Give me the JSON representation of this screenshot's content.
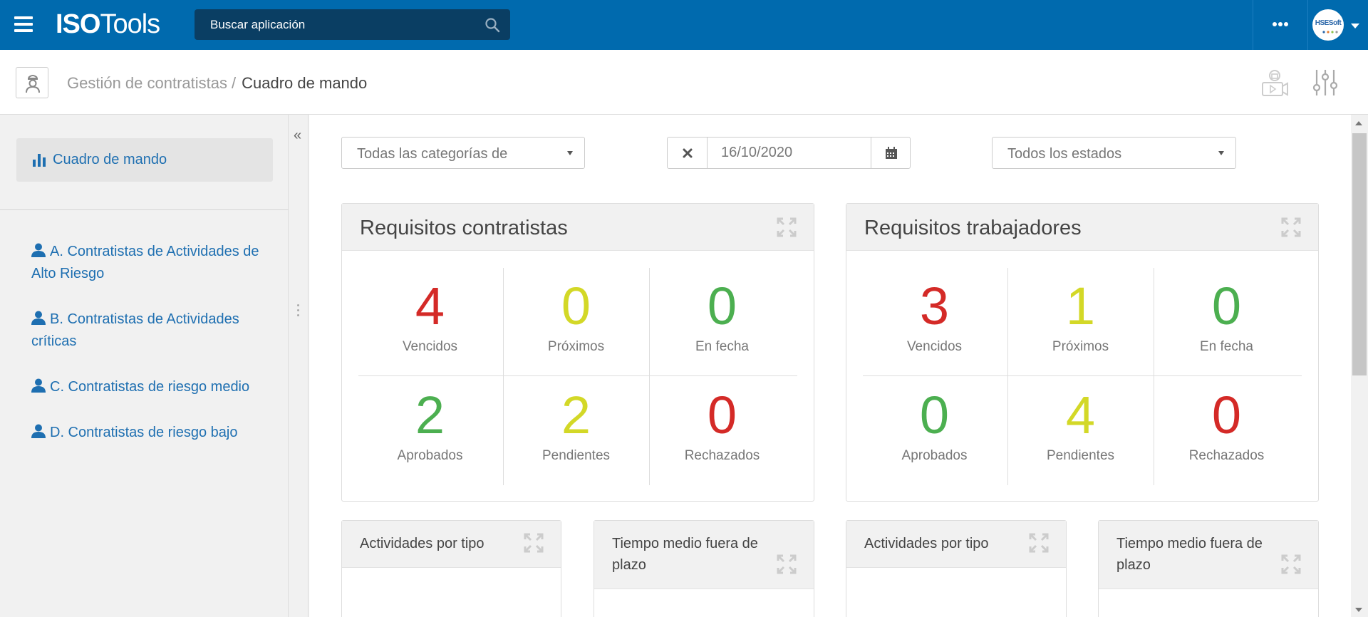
{
  "app": {
    "logo_bold": "ISO",
    "logo_light": "Tools"
  },
  "search": {
    "placeholder": "Buscar aplicación"
  },
  "user": {
    "avatar_text": "HSESoft"
  },
  "breadcrumb": {
    "parent": "Gestión de contratistas",
    "separator": "/",
    "current": "Cuadro de mando"
  },
  "sidebar": {
    "active_item": {
      "label": "Cuadro de mando",
      "icon": "bar-chart-icon"
    },
    "items": [
      {
        "label": "A. Contratistas de Actividades de Alto Riesgo",
        "icon": "user-icon"
      },
      {
        "label": "B. Contratistas de Actividades críticas",
        "icon": "user-icon"
      },
      {
        "label": "C. Contratistas de riesgo medio",
        "icon": "user-icon"
      },
      {
        "label": "D. Contratistas de riesgo bajo",
        "icon": "user-icon"
      }
    ],
    "collapse_symbol": "«"
  },
  "filters": {
    "category": "Todas las categorías de",
    "date": "16/10/2020",
    "status": "Todos los estados"
  },
  "colors": {
    "red": "#d42a27",
    "yellow": "#d3d827",
    "green": "#4caf50",
    "brand": "#006aae",
    "link": "#1e6fb1"
  },
  "panels": [
    {
      "title": "Requisitos contratistas",
      "stats": [
        {
          "value": "4",
          "label": "Vencidos",
          "color": "red"
        },
        {
          "value": "0",
          "label": "Próximos",
          "color": "yellow"
        },
        {
          "value": "0",
          "label": "En fecha",
          "color": "green"
        },
        {
          "value": "2",
          "label": "Aprobados",
          "color": "green"
        },
        {
          "value": "2",
          "label": "Pendientes",
          "color": "yellow"
        },
        {
          "value": "0",
          "label": "Rechazados",
          "color": "red"
        }
      ]
    },
    {
      "title": "Requisitos trabajadores",
      "stats": [
        {
          "value": "3",
          "label": "Vencidos",
          "color": "red"
        },
        {
          "value": "1",
          "label": "Próximos",
          "color": "yellow"
        },
        {
          "value": "0",
          "label": "En fecha",
          "color": "green"
        },
        {
          "value": "0",
          "label": "Aprobados",
          "color": "green"
        },
        {
          "value": "4",
          "label": "Pendientes",
          "color": "yellow"
        },
        {
          "value": "0",
          "label": "Rechazados",
          "color": "red"
        }
      ]
    }
  ],
  "small_panels": [
    {
      "title": "Actividades por tipo"
    },
    {
      "title": "Tiempo medio fuera de plazo"
    },
    {
      "title": "Actividades por tipo"
    },
    {
      "title": "Tiempo medio fuera de plazo"
    }
  ]
}
